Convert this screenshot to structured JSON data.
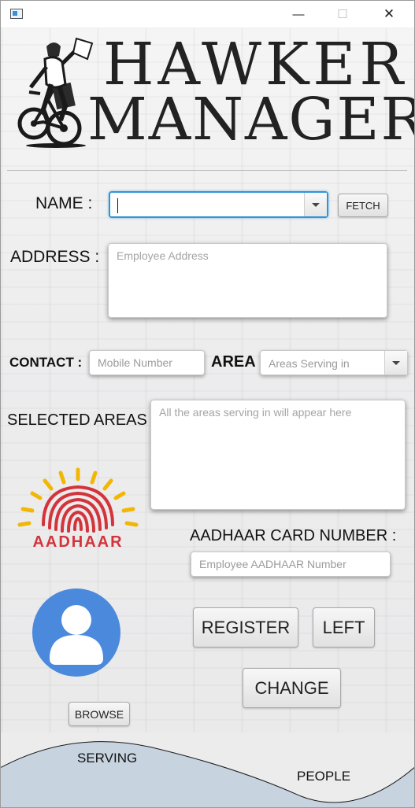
{
  "window": {
    "minimize_glyph": "—",
    "maximize_glyph": "☐",
    "close_glyph": "✕"
  },
  "header": {
    "title_line1": "HAWKER",
    "title_line2": "MANAGER"
  },
  "form": {
    "name_label": "NAME :",
    "name_value": "",
    "fetch_label": "FETCH",
    "address_label": "ADDRESS :",
    "address_placeholder": "Employee Address",
    "contact_label": "CONTACT :",
    "contact_placeholder": "Mobile Number",
    "area_label": "AREA",
    "area_placeholder": "Areas Serving in",
    "selected_areas_label": "SELECTED AREAS :",
    "selected_areas_placeholder": "All the areas serving in will appear here",
    "aadhaar_logo_text": "AADHAAR",
    "aadhaar_label": "AADHAAR CARD NUMBER :",
    "aadhaar_placeholder": "Employee AADHAAR Number",
    "browse_label": "BROWSE",
    "register_label": "REGISTER",
    "left_label": "LEFT",
    "change_label": "CHANGE"
  },
  "footer": {
    "serving_label": "SERVING",
    "people_label": "PEOPLE"
  },
  "colors": {
    "accent_focus": "#2f95d8",
    "avatar_blue": "#4a89dc",
    "aadhaar_red": "#d3343b",
    "aadhaar_yellow": "#f2b705",
    "wave_fill": "#c7d4e0"
  },
  "icons": [
    "app-icon",
    "cyclist-logo-icon",
    "aadhaar-logo-icon",
    "avatar-icon",
    "chevron-down-icon"
  ]
}
